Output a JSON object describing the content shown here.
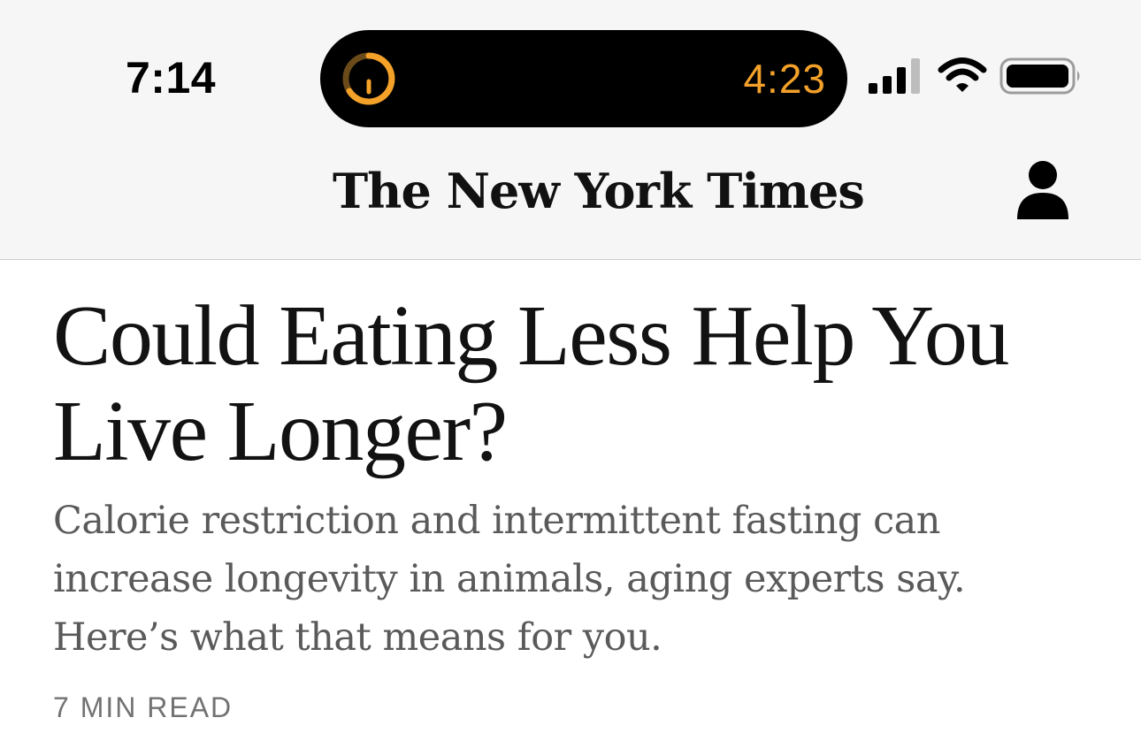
{
  "status_bar": {
    "time": "7:14",
    "live_activity": {
      "timer": "4:23",
      "accent_color": "#f4a12a",
      "icon": "timer-icon"
    },
    "icons": [
      "cellular-signal-icon",
      "wifi-icon",
      "battery-icon"
    ]
  },
  "header": {
    "masthead": "The New York Times",
    "account_icon": "account-icon"
  },
  "article": {
    "headline": "Could Eating Less Help You Live Longer?",
    "summary": "Calorie restriction and intermittent fasting can increase longevity in animals, aging experts say. Here’s what that means for you.",
    "read_time": "7 MIN READ"
  }
}
